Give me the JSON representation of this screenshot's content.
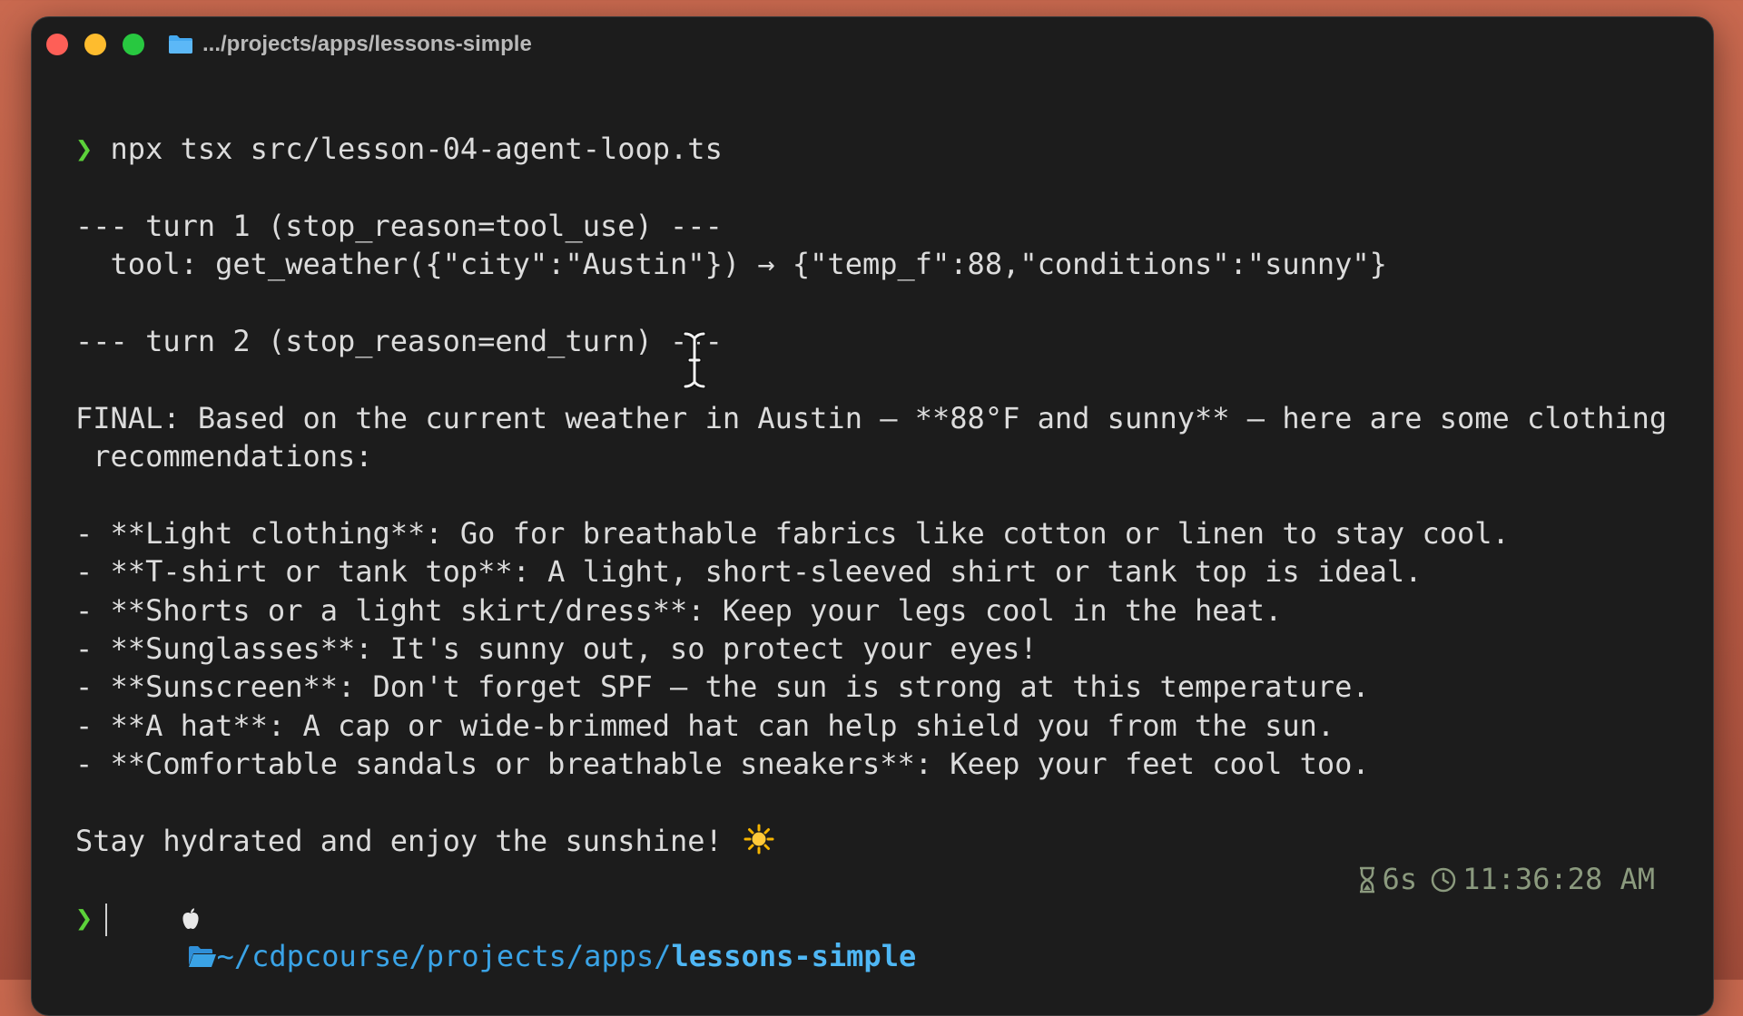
{
  "window": {
    "title": ".../projects/apps/lessons-simple",
    "folder_icon": "folder-icon",
    "traffic_lights": [
      "#fe5f57",
      "#febc2e",
      "#28c840"
    ]
  },
  "terminal": {
    "prompt_symbol": "❯",
    "command": "npx tsx src/lesson-04-agent-loop.ts",
    "lines": [
      "--- turn 1 (stop_reason=tool_use) ---",
      "  tool: get_weather({\"city\":\"Austin\"}) → {\"temp_f\":88,\"conditions\":\"sunny\"}",
      "",
      "--- turn 2 (stop_reason=end_turn) ---",
      "",
      "FINAL: Based on the current weather in Austin — **88°F and sunny** — here are some clothing",
      " recommendations:",
      "",
      "- **Light clothing**: Go for breathable fabrics like cotton or linen to stay cool.",
      "- **T-shirt or tank top**: A light, short-sleeved shirt or tank top is ideal.",
      "- **Shorts or a light skirt/dress**: Keep your legs cool in the heat.",
      "- **Sunglasses**: It's sunny out, so protect your eyes!",
      "- **Sunscreen**: Don't forget SPF — the sun is strong at this temperature.",
      "- **A hat**: A cap or wide-brimmed hat can help shield you from the sun.",
      "- **Comfortable sandals or breathable sneakers**: Keep your feet cool too.",
      "",
      "Stay hydrated and enjoy the sunshine!"
    ],
    "sun_emoji_icon": "sun-icon",
    "status": {
      "apple_icon": "",
      "path_prefix": "~/cdpcourse/projects/apps/",
      "path_current": "lessons-simple",
      "duration": "6s",
      "time": "11:36:28 AM"
    }
  },
  "colors": {
    "prompt_green": "#5cd23a",
    "path_blue": "#3aa3e6",
    "status_gray_green": "#8b9a7e",
    "terminal_bg": "#1c1c1c"
  }
}
